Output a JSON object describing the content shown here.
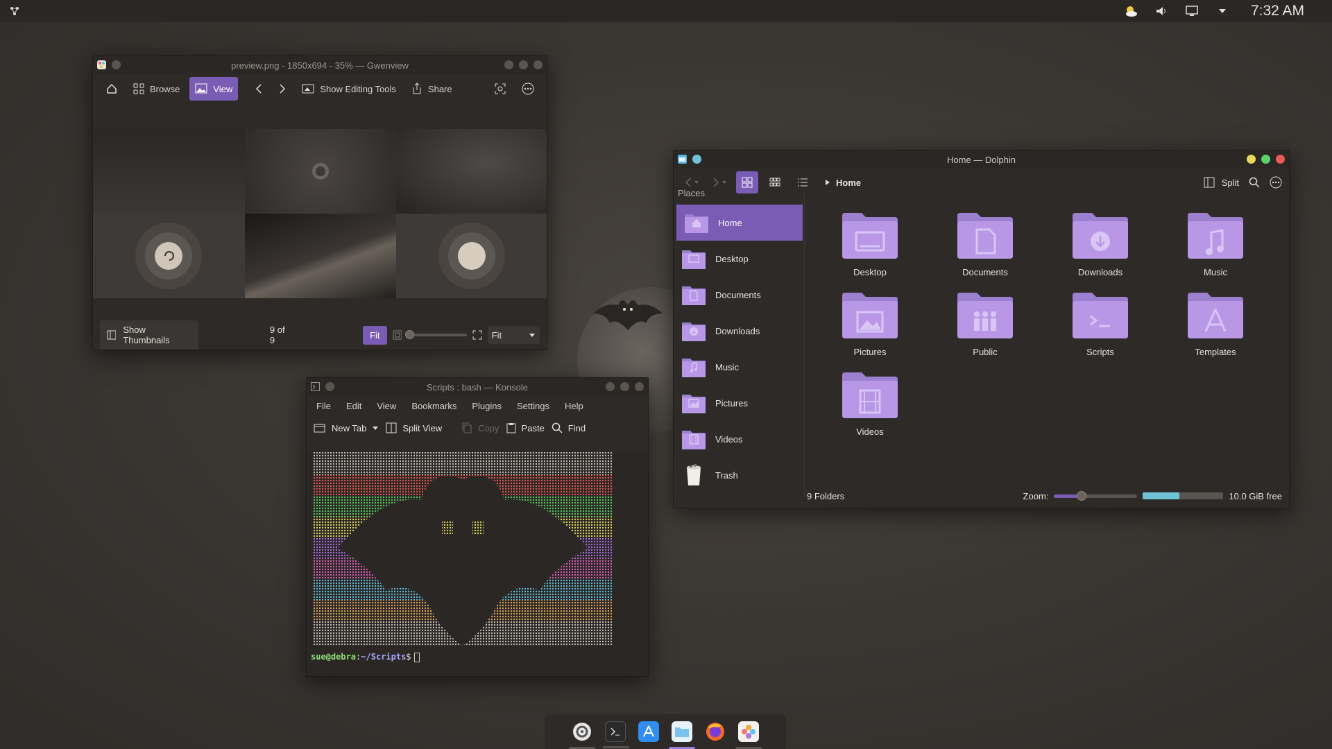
{
  "top_panel": {
    "clock": "7:32 AM",
    "icons": [
      "launcher-icon",
      "weather-icon",
      "volume-icon",
      "display-icon",
      "tray-expand-icon"
    ]
  },
  "gwenview": {
    "title": "preview.png - 1850x694 - 35% — Gwenview",
    "toolbar": {
      "browse": "Browse",
      "view": "View",
      "editing_tools": "Show Editing Tools",
      "share": "Share"
    },
    "status": {
      "show_thumbnails": "Show Thumbnails",
      "counter": "9 of 9",
      "fit_button": "Fit",
      "fit_select": "Fit"
    }
  },
  "konsole": {
    "title": "Scripts : bash — Konsole",
    "menu": [
      "File",
      "Edit",
      "View",
      "Bookmarks",
      "Plugins",
      "Settings",
      "Help"
    ],
    "toolbar": {
      "new_tab": "New Tab",
      "split_view": "Split View",
      "copy": "Copy",
      "paste": "Paste",
      "find": "Find"
    },
    "prompt": {
      "user": "sue@debra",
      "sep": ":",
      "path": "~/Scripts",
      "symbol": "$"
    }
  },
  "dolphin": {
    "title": "Home — Dolphin",
    "breadcrumb": "Home",
    "split": "Split",
    "places_title": "Places",
    "places": [
      {
        "label": "Home",
        "icon": "home-folder-icon",
        "active": true
      },
      {
        "label": "Desktop",
        "icon": "desktop-folder-icon"
      },
      {
        "label": "Documents",
        "icon": "documents-folder-icon"
      },
      {
        "label": "Downloads",
        "icon": "downloads-folder-icon"
      },
      {
        "label": "Music",
        "icon": "music-folder-icon"
      },
      {
        "label": "Pictures",
        "icon": "pictures-folder-icon"
      },
      {
        "label": "Videos",
        "icon": "videos-folder-icon"
      },
      {
        "label": "Trash",
        "icon": "trash-icon"
      }
    ],
    "folders": [
      "Desktop",
      "Documents",
      "Downloads",
      "Music",
      "Pictures",
      "Public",
      "Scripts",
      "Templates",
      "Videos"
    ],
    "status": {
      "count": "9 Folders",
      "zoom_label": "Zoom:",
      "free": "10.0 GiB free",
      "zoom_level": 0.33,
      "disk_used_fraction": 0.45
    }
  },
  "dock": {
    "apps": [
      "system-settings-icon",
      "terminal-icon",
      "app-store-icon",
      "files-icon",
      "firefox-icon",
      "photos-icon"
    ]
  },
  "colors": {
    "accent": "#7b5cb5",
    "folder": "#b898e6",
    "panel": "#2a2725",
    "disk_bar": "#6fc3d4"
  }
}
